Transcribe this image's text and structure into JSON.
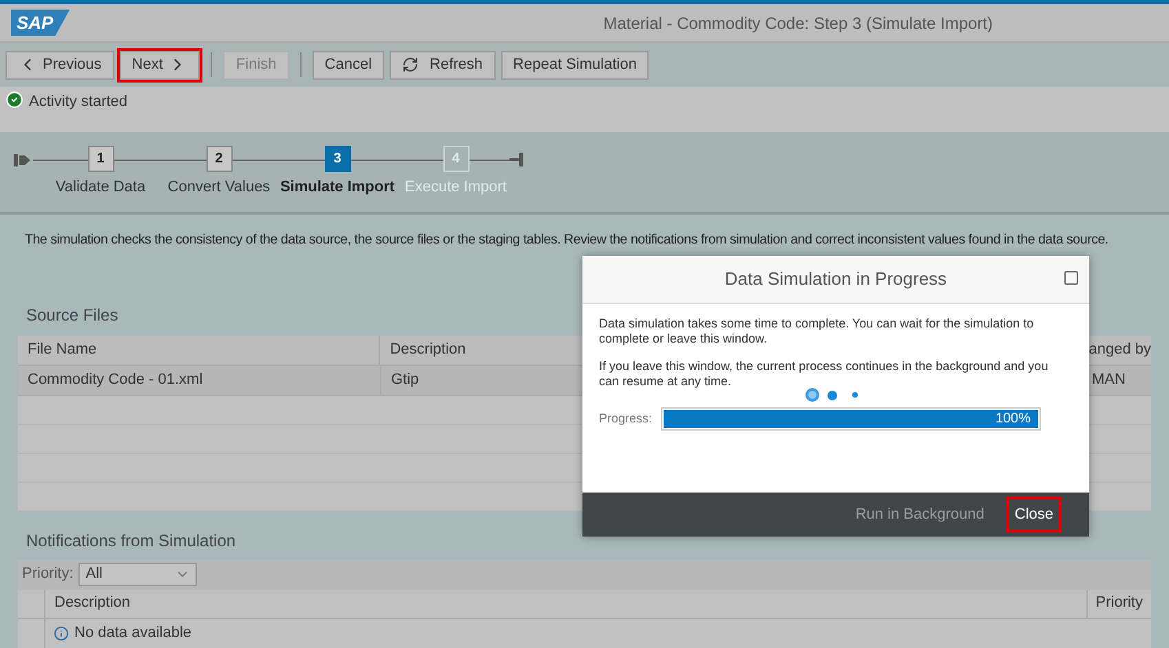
{
  "header": {
    "logo": "SAP",
    "title": "Material - Commodity Code: Step 3  (Simulate Import)"
  },
  "toolbar": [
    {
      "label": "Previous",
      "kind": "back",
      "disabled": false,
      "highlighted": false
    },
    {
      "label": "Next",
      "kind": "forward",
      "disabled": false,
      "highlighted": true
    },
    {
      "label": "Finish",
      "kind": "plain",
      "disabled": true,
      "highlighted": false
    },
    {
      "label": "Cancel",
      "kind": "plain",
      "disabled": false,
      "highlighted": false
    },
    {
      "label": "Refresh",
      "kind": "reload",
      "disabled": false,
      "highlighted": false
    },
    {
      "label": "Repeat Simulation",
      "kind": "plain",
      "disabled": false,
      "highlighted": false
    }
  ],
  "message": "Activity started",
  "steps": [
    {
      "number": "1",
      "label": "Validate Data",
      "kind": "done"
    },
    {
      "number": "2",
      "label": "Convert Values",
      "kind": "done"
    },
    {
      "number": "3",
      "label": "Simulate Import",
      "kind": "current"
    },
    {
      "number": "4",
      "label": "Execute Import",
      "kind": "upcoming"
    }
  ],
  "intro": "The simulation checks the consistency of the data source, the source files or the staging tables. Review the notifications from simulation and correct inconsistent values found in the data source.",
  "source_files": {
    "title": "Source Files",
    "columns": [
      "File Name",
      "Description",
      "anged by"
    ],
    "rows": [
      [
        "Commodity Code - 01.xml",
        "Gtip",
        "MAN"
      ]
    ]
  },
  "notifications": {
    "title": "Notifications from Simulation",
    "filter_label": "Priority:",
    "filter_value": "All",
    "columns": [
      "Description",
      "Priority"
    ],
    "empty": "No data available"
  },
  "dialog": {
    "title": "Data Simulation in Progress",
    "paragraphs": [
      "Data simulation takes some time to complete. You can wait for the simulation to complete or leave this window.",
      "If you leave this window, the current process continues in the background and you can resume at any time."
    ],
    "progress_label": "Progress:",
    "level": 1,
    "reading": "100%",
    "buttons": [
      {
        "label": "Run in Background",
        "highlighted": false
      },
      {
        "label": "Close",
        "highlighted": true
      }
    ]
  }
}
